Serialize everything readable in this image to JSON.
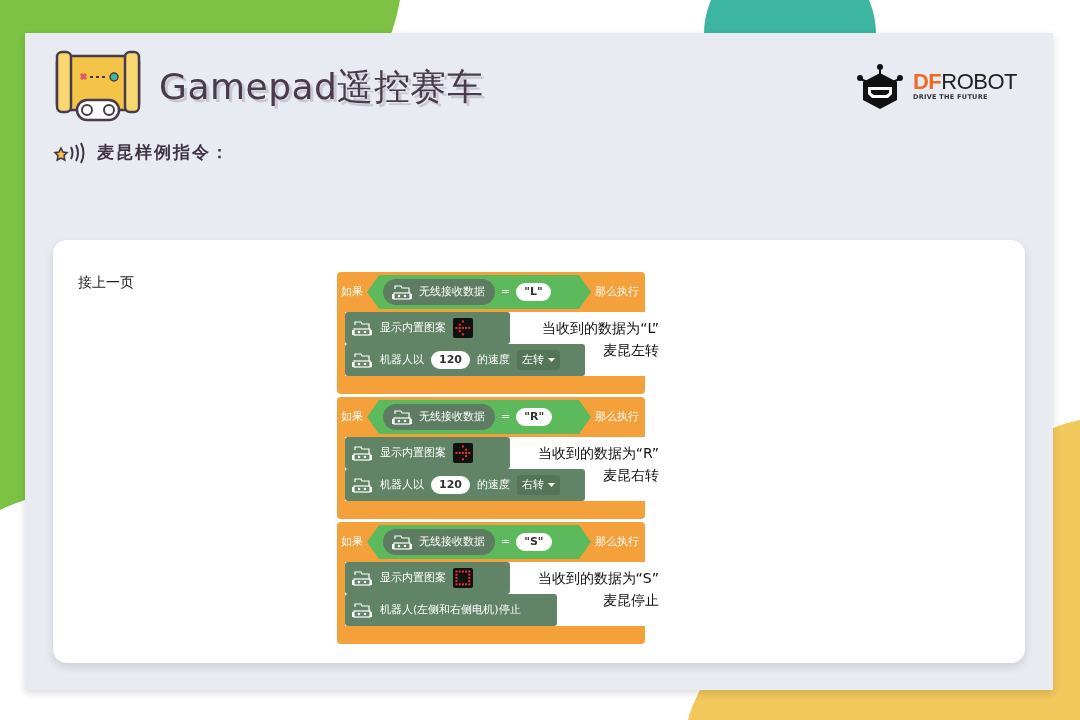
{
  "header": {
    "title": "Gamepad遥控赛车",
    "logo": {
      "accent": "DF",
      "rest": "ROBOT",
      "tagline": "DRIVE THE FUTURE"
    }
  },
  "subtitle": "麦昆样例指令：",
  "note": "接上一页",
  "blocks": [
    {
      "if_label": "如果",
      "sensor": "无线接收数据",
      "op": "=",
      "value": "\"L\"",
      "then_label": "那么执行",
      "statements": [
        {
          "kind": "pattern",
          "label": "显示内置图案"
        },
        {
          "kind": "move",
          "before": "机器人以",
          "speed": "120",
          "after": "的速度",
          "direction": "左转"
        }
      ],
      "caption_lines": [
        "当收到的数据为“L”",
        "麦昆左转"
      ]
    },
    {
      "if_label": "如果",
      "sensor": "无线接收数据",
      "op": "=",
      "value": "\"R\"",
      "then_label": "那么执行",
      "statements": [
        {
          "kind": "pattern",
          "label": "显示内置图案"
        },
        {
          "kind": "move",
          "before": "机器人以",
          "speed": "120",
          "after": "的速度",
          "direction": "右转"
        }
      ],
      "caption_lines": [
        "当收到的数据为“R”",
        "麦昆右转"
      ]
    },
    {
      "if_label": "如果",
      "sensor": "无线接收数据",
      "op": "=",
      "value": "\"S\"",
      "then_label": "那么执行",
      "statements": [
        {
          "kind": "pattern",
          "label": "显示内置图案"
        },
        {
          "kind": "stop",
          "label": "机器人(左侧和右侧电机)停止"
        }
      ],
      "caption_lines": [
        "当收到的数据为“S”",
        "麦昆停止"
      ]
    }
  ]
}
